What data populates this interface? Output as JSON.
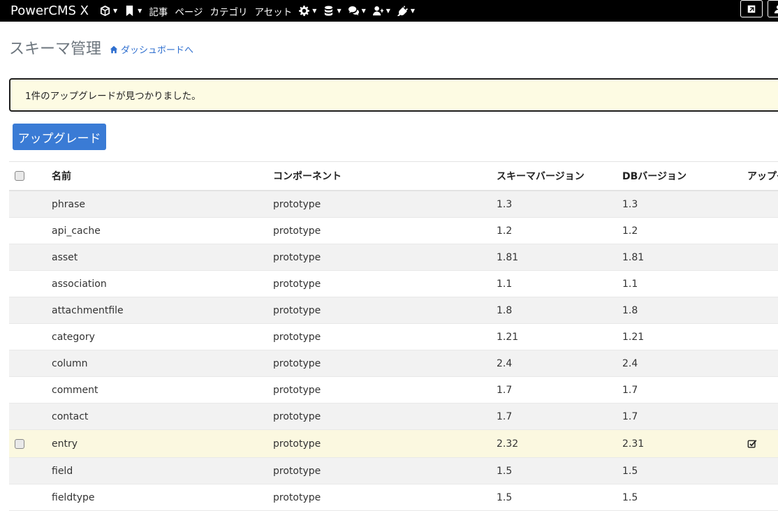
{
  "navbar": {
    "brand": "PowerCMS X",
    "text_items": [
      "記事",
      "ページ",
      "カテゴリ",
      "アセット"
    ]
  },
  "header": {
    "title": "スキーマ管理",
    "dashboard_link": "ダッシュボードへ"
  },
  "alert": {
    "message": "1件のアップグレードが見つかりました。"
  },
  "upgrade_button": {
    "label": "アップグレード"
  },
  "table": {
    "headers": [
      "名前",
      "コンポーネント",
      "スキーマバージョン",
      "DBバージョン",
      "アップグ"
    ],
    "rows": [
      {
        "name": "phrase",
        "component": "prototype",
        "schema": "1.3",
        "db": "1.3"
      },
      {
        "name": "api_cache",
        "component": "prototype",
        "schema": "1.2",
        "db": "1.2"
      },
      {
        "name": "asset",
        "component": "prototype",
        "schema": "1.81",
        "db": "1.81"
      },
      {
        "name": "association",
        "component": "prototype",
        "schema": "1.1",
        "db": "1.1"
      },
      {
        "name": "attachmentfile",
        "component": "prototype",
        "schema": "1.8",
        "db": "1.8"
      },
      {
        "name": "category",
        "component": "prototype",
        "schema": "1.21",
        "db": "1.21"
      },
      {
        "name": "column",
        "component": "prototype",
        "schema": "2.4",
        "db": "2.4"
      },
      {
        "name": "comment",
        "component": "prototype",
        "schema": "1.7",
        "db": "1.7"
      },
      {
        "name": "contact",
        "component": "prototype",
        "schema": "1.7",
        "db": "1.7"
      },
      {
        "name": "entry",
        "component": "prototype",
        "schema": "2.32",
        "db": "2.31"
      },
      {
        "name": "field",
        "component": "prototype",
        "schema": "1.5",
        "db": "1.5"
      },
      {
        "name": "fieldtype",
        "component": "prototype",
        "schema": "1.5",
        "db": "1.5"
      }
    ]
  },
  "colors": {
    "navbar_bg": "#000000",
    "link": "#2f6fcf",
    "button": "#3a7bd5",
    "alert_bg": "#fdfbe3",
    "highlight_row": "#fbf8e0"
  }
}
